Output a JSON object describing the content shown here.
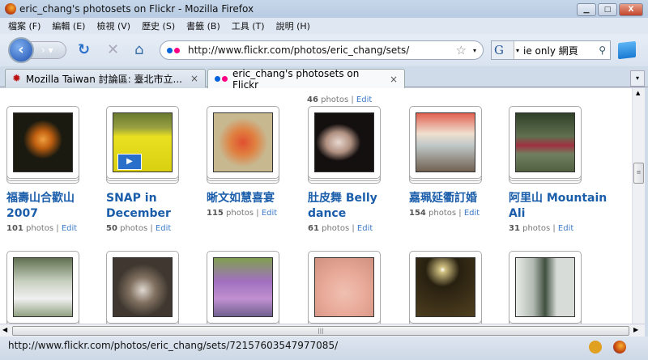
{
  "window": {
    "title": "eric_chang's photosets on Flickr - Mozilla Firefox",
    "min": "▁",
    "max": "□",
    "close": "X"
  },
  "menu": [
    "檔案 (F)",
    "編輯 (E)",
    "檢視 (V)",
    "歷史 (S)",
    "書籤 (B)",
    "工具 (T)",
    "說明 (H)"
  ],
  "nav": {
    "url": "http://www.flickr.com/photos/eric_chang/sets/",
    "search_value": "ie only 網頁",
    "search_engine": "G"
  },
  "tabs": [
    {
      "label": "Mozilla Taiwan 討論區: 臺北市立...",
      "close": "×"
    },
    {
      "label": "eric_chang's photosets on Flickr",
      "close": "×"
    }
  ],
  "top_partial": {
    "count": "46",
    "photos": "photos",
    "edit": "Edit"
  },
  "sets_row1": [
    {
      "title": "福壽山合歡山 2007",
      "count": "101"
    },
    {
      "title": "SNAP in December",
      "count": "50",
      "video": "▶"
    },
    {
      "title": "晰文如慧喜宴",
      "count": "115"
    },
    {
      "title": "肚皮舞 Belly dance",
      "count": "61"
    },
    {
      "title": "嘉珮延衢訂婚",
      "count": "154"
    },
    {
      "title": "阿里山 Mountain Ali",
      "count": "31"
    }
  ],
  "labels": {
    "photos": "photos",
    "sep": "|",
    "edit": "Edit"
  },
  "status": {
    "text": "http://www.flickr.com/photos/eric_chang/sets/72157603547977085/"
  },
  "colors": {
    "link": "#1a5daa",
    "flickr_blue": "#0063dc",
    "flickr_pink": "#ff0084"
  }
}
